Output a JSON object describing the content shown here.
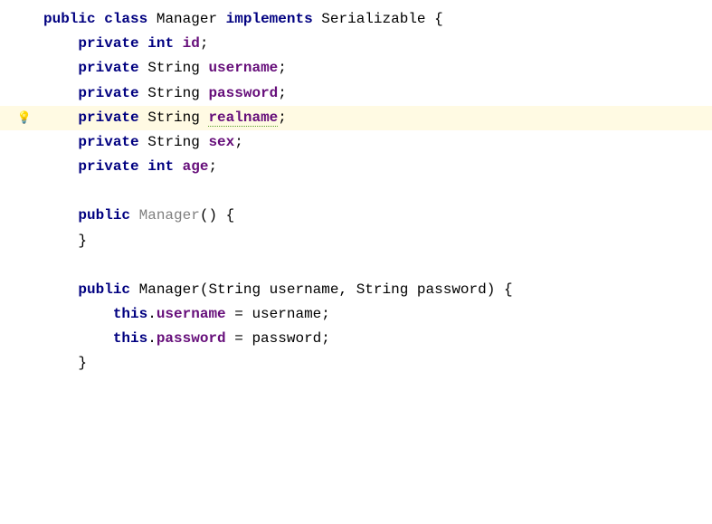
{
  "code": {
    "kw_public": "public",
    "kw_class": "class",
    "class_name": "Manager",
    "kw_implements": "implements",
    "iface": "Serializable",
    "brace_open": "{",
    "brace_close": "}",
    "kw_private": "private",
    "type_int": "int",
    "type_string": "String",
    "field_id": "id",
    "field_username": "username",
    "field_password": "password",
    "field_realname": "realname",
    "field_sex": "sex",
    "field_age": "age",
    "semicolon": ";",
    "paren_open": "(",
    "paren_close": ")",
    "ctor_name": "Manager",
    "param_username": "username",
    "param_password": "password",
    "comma_sp": ", ",
    "kw_this": "this",
    "dot": ".",
    "assign": " = ",
    "sp": " "
  }
}
